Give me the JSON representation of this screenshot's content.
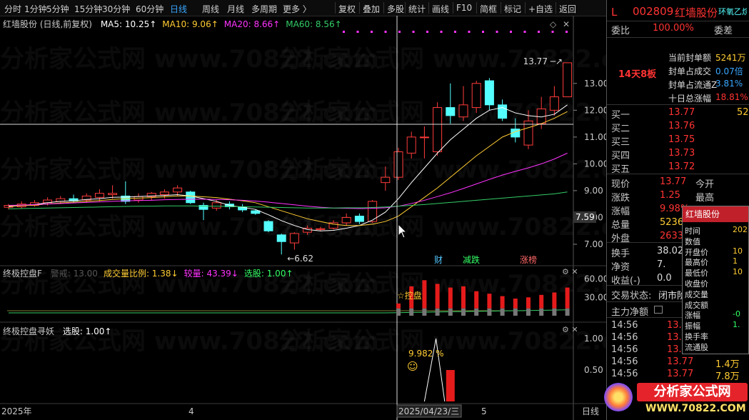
{
  "toolbar": {
    "left": [
      "分时",
      "1分钟",
      "5分钟",
      "15分钟",
      "30分钟",
      "60分钟",
      "日线",
      "周线",
      "月线",
      "多周期",
      "更多 〉"
    ],
    "active": "日线",
    "right": [
      "复权",
      "叠加",
      "多股",
      "统计",
      "画线",
      "F10",
      "简框",
      "标记",
      "+自选",
      "返回"
    ]
  },
  "main_chart": {
    "title": "红墙股份 (日线,前复权)",
    "ma": [
      {
        "label": "MA5: 10.25↑",
        "color": "#ffffff"
      },
      {
        "label": "MA10: 9.06↑",
        "color": "#ffcc33"
      },
      {
        "label": "MA20: 8.66↑",
        "color": "#ff33ff"
      },
      {
        "label": "MA60: 8.56↑",
        "color": "#33cc66"
      }
    ],
    "y_ticks": [
      "13.00",
      "12.00",
      "11.00",
      "10.00",
      "9.00",
      "8.00",
      "7.00"
    ],
    "cursor_price": "7.59",
    "high_label": "13.77",
    "low_label": "6.62",
    "markers": [
      {
        "text": "财",
        "color": "#54c8ff"
      },
      {
        "text": "减跌",
        "color": "#33ff66"
      },
      {
        "text": "涨榜",
        "color": "#ff6666"
      }
    ]
  },
  "ind1": {
    "title": "终极控盘F",
    "items": [
      {
        "label": "警戒: 13.00",
        "color": "#555555"
      },
      {
        "label": "成交量比例: 1.38↓",
        "color": "#ffcc33"
      },
      {
        "label": "较量: 43.39↓",
        "color": "#ff33ff"
      },
      {
        "label": "选股: 1.00↑",
        "color": "#33ff66"
      }
    ],
    "y_ticks": [
      "60.00",
      "30.00"
    ],
    "annotation": "☆控盘"
  },
  "ind2": {
    "title": "终极控盘寻妖",
    "items": [
      {
        "label": "选股: 1.00↑",
        "color": "#ffffff"
      }
    ],
    "y_ticks": [
      "1.00",
      "0.50"
    ],
    "annotation": "9.982 %",
    "smiley": "☺"
  },
  "x_axis": {
    "labels": [
      "2025年",
      "4",
      "2025/04/23/三",
      "5"
    ],
    "period": "日线"
  },
  "stock": {
    "flag": "L",
    "code": "002809",
    "name": "红墙股份",
    "tag": "环氧乙烷",
    "weibi_label": "委比",
    "weibi_value": "100.00%",
    "weicha_label": "委差",
    "board_streak": "14天8板",
    "seal": [
      {
        "label": "当前封单额",
        "value": "5241万",
        "color": "#ffcc33"
      },
      {
        "label": "封单占成交",
        "value": "0.07倍",
        "color": "#39a6ff"
      },
      {
        "label": "封单占流通Z",
        "value": "3.81%",
        "color": "#39a6ff"
      },
      {
        "label": "十日总涨幅",
        "value": "18.81%",
        "color": "#ff3333"
      }
    ],
    "bids": [
      {
        "label": "买一",
        "price": "13.77",
        "vol": "52"
      },
      {
        "label": "买二",
        "price": "13.76",
        "vol": ""
      },
      {
        "label": "买三",
        "price": "13.75",
        "vol": ""
      },
      {
        "label": "买四",
        "price": "13.73",
        "vol": ""
      },
      {
        "label": "买五",
        "price": "13.72",
        "vol": ""
      }
    ],
    "quote": [
      {
        "label": "现价",
        "value": "13.77",
        "color": "#ff3333",
        "label2": "今开"
      },
      {
        "label": "涨跌",
        "value": "1.25",
        "color": "#ff3333",
        "label2": "最高"
      },
      {
        "label": "涨幅",
        "value": "9.98%",
        "color": "#ff3333",
        "label2": "最低"
      },
      {
        "label": "总量",
        "value": "5236",
        "color": "#ffcc33",
        "label2": ""
      },
      {
        "label": "外盘",
        "value": "2633",
        "color": "#ff3333",
        "label2": ""
      }
    ],
    "more": [
      {
        "label": "换手",
        "value": "38.02"
      },
      {
        "label": "净资",
        "value": "7."
      },
      {
        "label": "收益(-)",
        "value": "0.0"
      }
    ],
    "trade_status_label": "交易状态:",
    "trade_status_value": "闭市阶",
    "main_flow_label": "主力净额",
    "ticks": [
      {
        "time": "14:56",
        "price": "13.7",
        "vol": ""
      },
      {
        "time": "14:56",
        "price": "13.7",
        "vol": ""
      },
      {
        "time": "14:56",
        "price": "13.7",
        "vol": ""
      },
      {
        "time": "14:56",
        "price": "13.77",
        "vol": "1.4万"
      },
      {
        "time": "14:56",
        "price": "13.77",
        "vol": "7.8万"
      }
    ]
  },
  "popup": {
    "title": "红墙股份",
    "rows": [
      {
        "label": "时间",
        "value": "202"
      },
      {
        "label": "数值",
        "value": ""
      },
      {
        "label": "开盘价",
        "value": "10"
      },
      {
        "label": "最高价",
        "value": "1"
      },
      {
        "label": "最低价",
        "value": "10"
      },
      {
        "label": "收盘价",
        "value": ""
      },
      {
        "label": "成交量",
        "value": ""
      },
      {
        "label": "成交额",
        "value": ""
      },
      {
        "label": "涨幅",
        "value": "-0"
      },
      {
        "label": "振幅",
        "value": "1."
      },
      {
        "label": "换手率",
        "value": ""
      },
      {
        "label": "流通股",
        "value": ""
      }
    ]
  },
  "watermark": "分析家公式网 www.70822.com",
  "logo": {
    "text": "分析家公式网",
    "url": "WWW.70822.COM"
  },
  "chart_data": {
    "type": "candlestick",
    "ylim": [
      6.2,
      14.3
    ],
    "candles": [
      [
        8.38,
        8.45,
        8.3,
        8.5
      ],
      [
        8.4,
        8.5,
        8.32,
        8.6
      ],
      [
        8.45,
        8.55,
        8.4,
        8.65
      ],
      [
        8.55,
        8.65,
        8.45,
        8.75
      ],
      [
        8.6,
        8.7,
        8.5,
        8.8
      ],
      [
        8.7,
        8.62,
        8.55,
        8.85
      ],
      [
        8.65,
        8.8,
        8.55,
        8.9
      ],
      [
        8.75,
        8.9,
        8.6,
        9.05
      ],
      [
        8.85,
        8.9,
        8.7,
        9.2
      ],
      [
        8.8,
        8.6,
        8.5,
        9.35
      ],
      [
        8.65,
        8.78,
        8.55,
        8.9
      ],
      [
        8.78,
        8.9,
        8.65,
        8.95
      ],
      [
        8.85,
        8.95,
        8.7,
        9.05
      ],
      [
        8.95,
        9.1,
        8.8,
        9.2
      ],
      [
        8.95,
        8.55,
        8.5,
        9.0
      ],
      [
        8.45,
        8.3,
        7.9,
        8.55
      ],
      [
        8.35,
        8.55,
        8.25,
        8.65
      ],
      [
        8.5,
        8.4,
        8.3,
        8.6
      ],
      [
        8.4,
        8.28,
        8.2,
        8.5
      ],
      [
        8.25,
        8.15,
        8.1,
        8.3
      ],
      [
        7.85,
        7.5,
        7.45,
        7.9
      ],
      [
        7.35,
        7.1,
        6.62,
        7.4
      ],
      [
        7.05,
        7.4,
        6.8,
        7.45
      ],
      [
        7.45,
        7.6,
        7.35,
        7.7
      ],
      [
        7.55,
        7.58,
        7.48,
        7.65
      ],
      [
        7.6,
        7.8,
        7.55,
        7.9
      ],
      [
        7.8,
        8.0,
        7.7,
        8.15
      ],
      [
        8.05,
        7.85,
        7.75,
        8.15
      ],
      [
        7.85,
        8.6,
        7.8,
        8.65
      ],
      [
        9.3,
        9.5,
        9.0,
        9.9
      ],
      [
        9.5,
        10.45,
        9.4,
        10.6
      ],
      [
        10.4,
        11.0,
        10.2,
        11.2
      ],
      [
        11.0,
        11.0,
        10.2,
        11.4
      ],
      [
        10.45,
        12.1,
        10.3,
        12.3
      ],
      [
        12.1,
        11.8,
        11.5,
        13.0
      ],
      [
        11.75,
        12.2,
        11.6,
        12.9
      ],
      [
        12.1,
        13.0,
        11.9,
        13.1
      ],
      [
        13.1,
        12.2,
        12.0,
        13.2
      ],
      [
        12.2,
        11.7,
        11.6,
        12.4
      ],
      [
        11.3,
        11.0,
        10.8,
        11.7
      ],
      [
        10.7,
        11.6,
        10.55,
        12.0
      ],
      [
        11.5,
        12.05,
        11.3,
        12.5
      ],
      [
        12.0,
        12.5,
        11.8,
        12.9
      ],
      [
        12.5,
        13.77,
        12.5,
        13.77
      ]
    ],
    "ma5": [
      8.4,
      8.45,
      8.48,
      8.55,
      8.6,
      8.62,
      8.67,
      8.7,
      8.75,
      8.76,
      8.78,
      8.8,
      8.82,
      8.85,
      8.8,
      8.7,
      8.6,
      8.45,
      8.38,
      8.3,
      8.1,
      7.88,
      7.7,
      7.55,
      7.5,
      7.52,
      7.6,
      7.7,
      7.9,
      8.2,
      8.7,
      9.3,
      9.85,
      10.4,
      10.9,
      11.3,
      11.7,
      12.0,
      12.1,
      11.9,
      11.8,
      11.75,
      11.85,
      12.2
    ],
    "ma10": [
      8.42,
      8.44,
      8.46,
      8.5,
      8.54,
      8.57,
      8.6,
      8.63,
      8.67,
      8.7,
      8.72,
      8.74,
      8.77,
      8.8,
      8.8,
      8.77,
      8.74,
      8.68,
      8.62,
      8.55,
      8.4,
      8.25,
      8.1,
      7.95,
      7.85,
      7.75,
      7.7,
      7.7,
      7.75,
      7.85,
      8.05,
      8.4,
      8.75,
      9.1,
      9.5,
      9.9,
      10.3,
      10.65,
      11.0,
      11.2,
      11.35,
      11.5,
      11.7,
      11.95
    ],
    "ma20": [
      8.45,
      8.46,
      8.48,
      8.5,
      8.52,
      8.54,
      8.56,
      8.58,
      8.6,
      8.62,
      8.63,
      8.64,
      8.66,
      8.67,
      8.68,
      8.68,
      8.67,
      8.66,
      8.64,
      8.61,
      8.57,
      8.52,
      8.47,
      8.42,
      8.38,
      8.35,
      8.34,
      8.33,
      8.34,
      8.36,
      8.42,
      8.52,
      8.64,
      8.78,
      8.92,
      9.08,
      9.25,
      9.42,
      9.58,
      9.72,
      9.85,
      10.0,
      10.18,
      10.4
    ],
    "ma60": [
      8.32,
      8.33,
      8.34,
      8.35,
      8.36,
      8.37,
      8.38,
      8.39,
      8.4,
      8.41,
      8.42,
      8.42,
      8.43,
      8.43,
      8.43,
      8.42,
      8.42,
      8.41,
      8.4,
      8.39,
      8.38,
      8.37,
      8.36,
      8.35,
      8.35,
      8.35,
      8.36,
      8.36,
      8.37,
      8.39,
      8.42,
      8.45,
      8.48,
      8.52,
      8.56,
      8.6,
      8.64,
      8.68,
      8.72,
      8.76,
      8.8,
      8.84,
      8.88,
      8.95
    ],
    "ind1_red": [
      0,
      0,
      0,
      0,
      0,
      0,
      0,
      0,
      0,
      0,
      0,
      0,
      0,
      0,
      0,
      0,
      0,
      0,
      0,
      0,
      0,
      0,
      0,
      0,
      0,
      0,
      0,
      0,
      0,
      0,
      8,
      36,
      46,
      40,
      34,
      36,
      28,
      24,
      20,
      16,
      18,
      22,
      26,
      34
    ],
    "ind1_gray": [
      0,
      0,
      0,
      0,
      0,
      0,
      0,
      0,
      0,
      0,
      0,
      0,
      0,
      0,
      0,
      0,
      0,
      0,
      0,
      0,
      0,
      0,
      0,
      0,
      0,
      0,
      0,
      0,
      0,
      0,
      12,
      12,
      12,
      12,
      12,
      12,
      12,
      12,
      12,
      12,
      12,
      12,
      12,
      12
    ],
    "ind2_line": {
      "peak_index": 33,
      "value": 1.0
    },
    "ind2_bar": {
      "index": 34,
      "value": 0.5
    }
  }
}
